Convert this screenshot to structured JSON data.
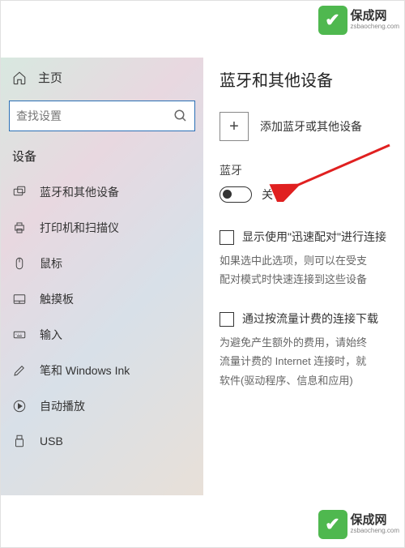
{
  "sidebar": {
    "home_label": "主页",
    "search_placeholder": "查找设置",
    "category": "设备",
    "items": [
      {
        "label": "蓝牙和其他设备"
      },
      {
        "label": "打印机和扫描仪"
      },
      {
        "label": "鼠标"
      },
      {
        "label": "触摸板"
      },
      {
        "label": "输入"
      },
      {
        "label": "笔和 Windows Ink"
      },
      {
        "label": "自动播放"
      },
      {
        "label": "USB"
      }
    ]
  },
  "content": {
    "title": "蓝牙和其他设备",
    "add_label": "添加蓝牙或其他设备",
    "subtitle": "蓝牙",
    "toggle_label": "关",
    "checkbox1_label": "显示使用\"迅速配对\"进行连接",
    "desc1": "如果选中此选项，则可以在受支\n配对模式时快速连接到这些设备",
    "checkbox2_label": "通过按流量计费的连接下载",
    "desc2": "为避免产生额外的费用，请始终\n流量计费的 Internet 连接时，就\n软件(驱动程序、信息和应用)"
  },
  "watermark": {
    "cn": "保成网",
    "en": "zsbaocheng.com"
  }
}
